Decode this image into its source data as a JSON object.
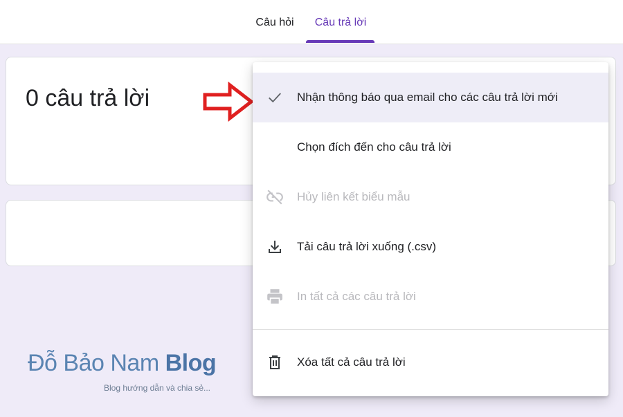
{
  "tabs": {
    "questions": "Câu hỏi",
    "responses": "Câu trả lời",
    "active": "responses"
  },
  "summary": {
    "response_count": "0 câu trả lời"
  },
  "menu": {
    "items": [
      {
        "label": "Nhận thông báo qua email cho các câu trả lời mới",
        "icon": "check-icon",
        "checked": true,
        "disabled": false
      },
      {
        "label": "Chọn đích đến cho câu trả lời",
        "icon": "",
        "disabled": false
      },
      {
        "label": "Hủy liên kết biểu mẫu",
        "icon": "link-off-icon",
        "disabled": true
      },
      {
        "label": "Tải câu trả lời xuống (.csv)",
        "icon": "download-icon",
        "disabled": false
      },
      {
        "label": "In tất cả các câu trả lời",
        "icon": "print-icon",
        "disabled": true
      },
      {
        "label": "Xóa tất cả câu trả lời",
        "icon": "trash-icon",
        "disabled": false
      }
    ]
  },
  "watermark": {
    "title_regular": "Đỗ Bảo Nam ",
    "title_bold": "Blog",
    "subtitle": "Blog hướng dẫn và chia sẻ..."
  },
  "colors": {
    "accent": "#673ab7",
    "background": "#efebf8",
    "highlight": "#eeedf7",
    "arrow": "#e02020",
    "disabled_text": "#b8b8bc"
  }
}
